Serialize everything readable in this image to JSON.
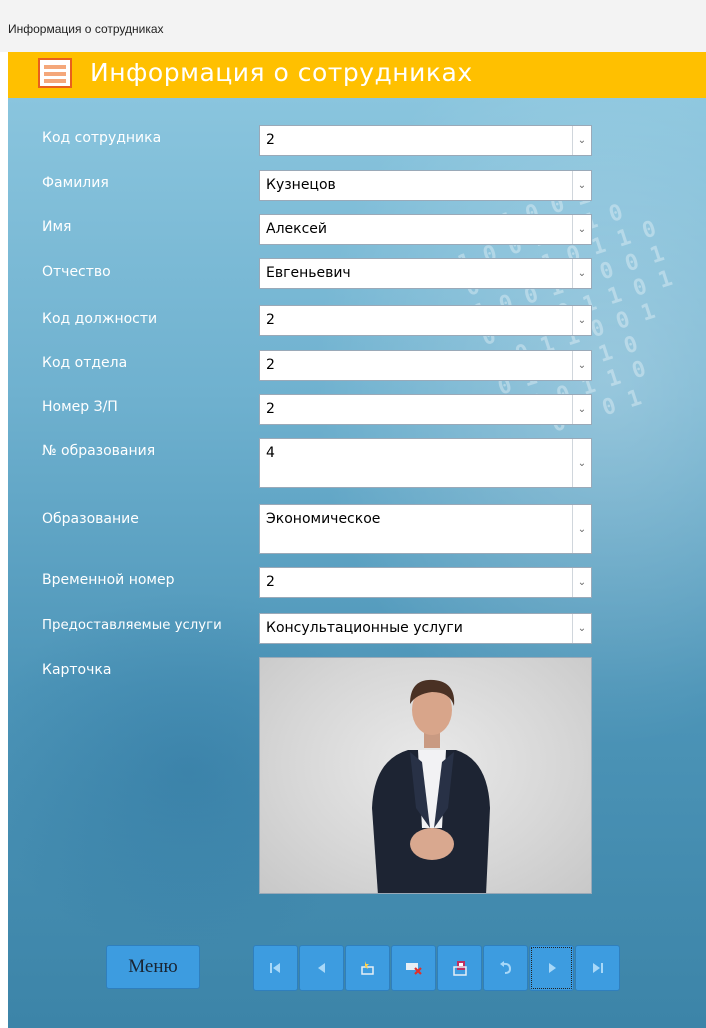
{
  "window": {
    "title": "Информация о сотрудниках"
  },
  "header": {
    "title": "Информация о сотрудниках"
  },
  "fields": [
    {
      "label": "Код сотрудника",
      "value": "2"
    },
    {
      "label": "Фамилия",
      "value": "Кузнецов"
    },
    {
      "label": "Имя",
      "value": "Алексей"
    },
    {
      "label": "Отчество",
      "value": "Евгеньевич"
    },
    {
      "label": "Код должности",
      "value": "2"
    },
    {
      "label": "Код отдела",
      "value": "2"
    },
    {
      "label": "Номер З/П",
      "value": "2"
    },
    {
      "label": "№ образования",
      "value": "4"
    },
    {
      "label": "Образование",
      "value": "Экономическое"
    },
    {
      "label": "Временной номер",
      "value": "2"
    },
    {
      "label": "Предоставляемые услуги",
      "value": "Консультационные услуги"
    }
  ],
  "photo": {
    "label": "Карточка"
  },
  "buttons": {
    "menu_label": "Меню"
  },
  "nav_icons": [
    "first-record-icon",
    "previous-record-icon",
    "new-record-icon",
    "delete-record-icon",
    "save-record-icon",
    "undo-icon",
    "next-record-icon",
    "last-record-icon"
  ],
  "colors": {
    "header": "#ffc000",
    "button": "#3d9ce0",
    "icon_light": "#a8d8f8"
  }
}
